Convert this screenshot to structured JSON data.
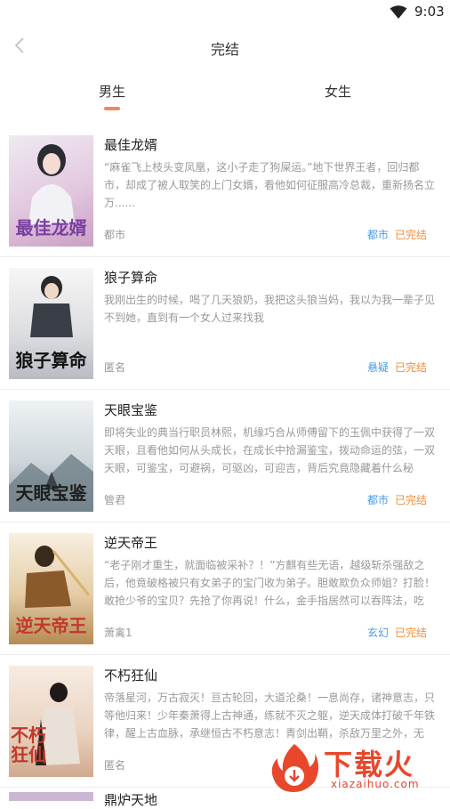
{
  "status_bar": {
    "time": "9:03",
    "icons": [
      "wifi-icon"
    ]
  },
  "header": {
    "title": "完结",
    "back_icon": "chevron-left-icon"
  },
  "tabs": [
    {
      "label": "男生",
      "active": true
    },
    {
      "label": "女生",
      "active": false
    }
  ],
  "books": [
    {
      "title": "最佳龙婿",
      "description": "“麻雀飞上枝头变凤凰，这小子走了狗屎运。”地下世界王者，回归都市，却成了被人取笑的上门女婿，看他如何征服高冷总裁，重新扬名立万......",
      "author": "都市",
      "tag": "都市",
      "status": "已完结",
      "cover_text": "最佳龙婿",
      "cover_colors": [
        "#e9e6ef",
        "#c9a4c8"
      ]
    },
    {
      "title": "狼子算命",
      "description": "我刚出生的时候，喝了几天狼奶，我把这头狼当妈，我以为我一辈子见不到她，直到有一个女人过来找我",
      "author": "匿名",
      "tag": "悬疑",
      "status": "已完结",
      "cover_text": "狼子算命",
      "cover_colors": [
        "#f1f1f1",
        "#9aa0a6"
      ]
    },
    {
      "title": "天眼宝鉴",
      "description": "即将失业的典当行职员林熙，机缘巧合从师傅留下的玉佩中获得了一双天眼，且看他如何从头成长，在成长中拾漏鉴宝，拨动命运的弦，一双天眼，可鉴宝，可避祸，可驱凶，可迎吉，背后究竟隐藏着什么秘密......",
      "author": "管君",
      "tag": "都市",
      "status": "已完结",
      "cover_text": "天眼宝鉴",
      "cover_colors": [
        "#dfe6ea",
        "#7f8e96"
      ]
    },
    {
      "title": "逆天帝王",
      "description": "“老子刚才重生，就面临被采补？！”方麒有些无语，越级斩杀强敌之后，他竟破格被只有女弟子的宝门收为弟子。胆敢欺负众师姐？打脸！敢抢少爷的宝贝？先抢了你再说！什么，金手指居然可以吞阵法，吃灵......",
      "author": "萧禽1",
      "tag": "玄幻",
      "status": "已完结",
      "cover_text": "逆天帝王",
      "cover_colors": [
        "#f5e9d6",
        "#b88a55"
      ]
    },
    {
      "title": "不朽狂仙",
      "description": "帝落星河，万古寂灭！亘古轮回，大道沦桑！一息尚存，诸神意志，只等他归来！少年秦萧得上古神通，练就不灭之躯，逆天成体打破千年铁律，醒上古血脉，承继恒古不朽意志！青剑出鞘，杀敌万里之外，无上......",
      "author": "匿名",
      "tag": "",
      "status": "",
      "cover_text": "不朽狂仙",
      "cover_colors": [
        "#f3e4d8",
        "#c0392b"
      ]
    }
  ],
  "partial_title": "鼎炉天地",
  "watermark": {
    "text": "下载火",
    "url": "xiazaihuo.com"
  }
}
